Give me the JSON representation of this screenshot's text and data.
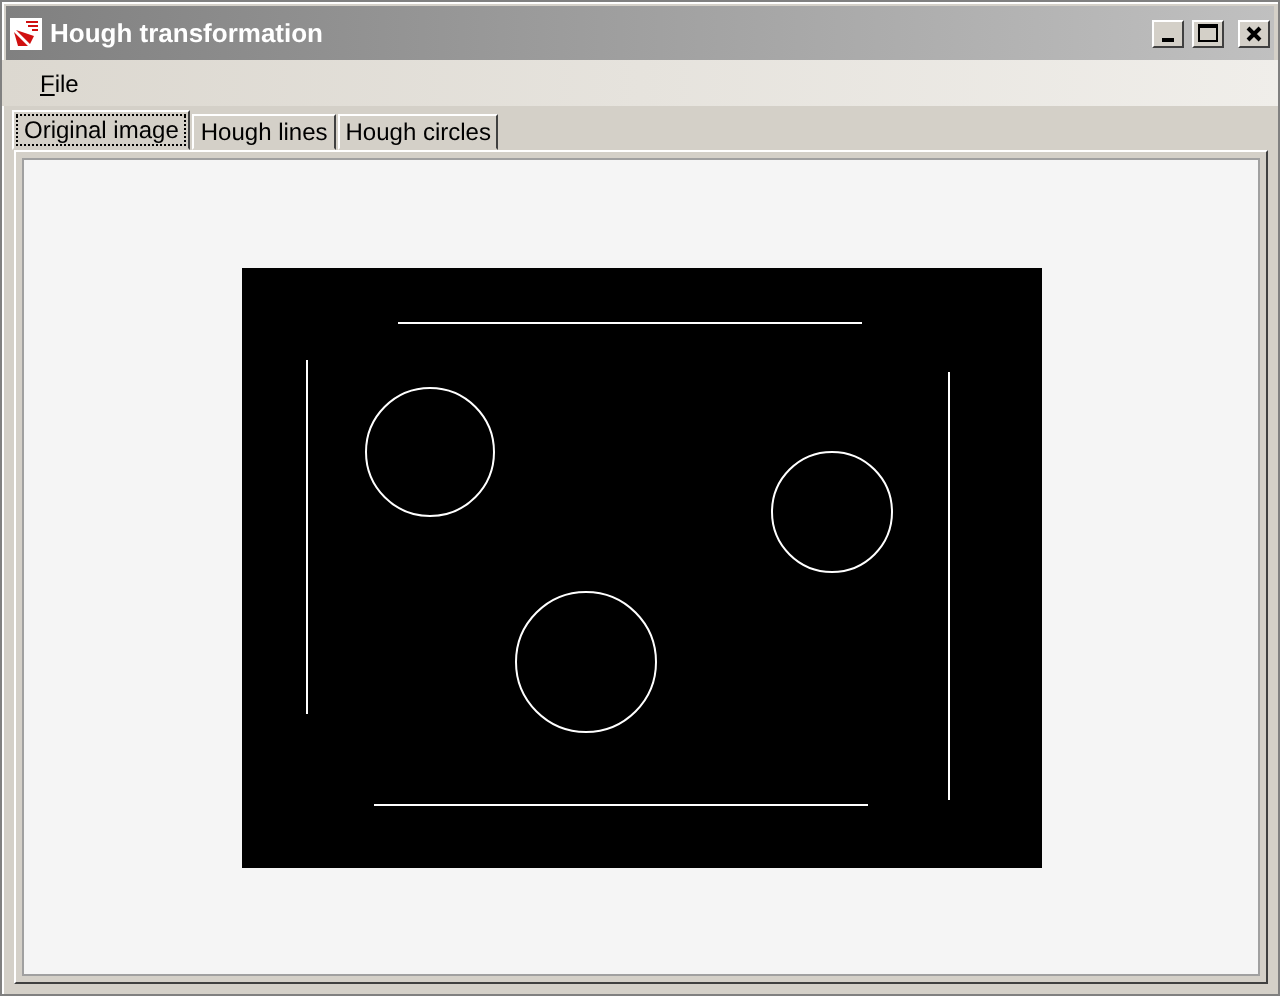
{
  "window": {
    "title": "Hough transformation"
  },
  "menu": [
    {
      "label": "File"
    }
  ],
  "tabs": [
    {
      "label": "Original image",
      "selected": true
    },
    {
      "label": "Hough lines",
      "selected": false
    },
    {
      "label": "Hough circles",
      "selected": false
    }
  ]
}
